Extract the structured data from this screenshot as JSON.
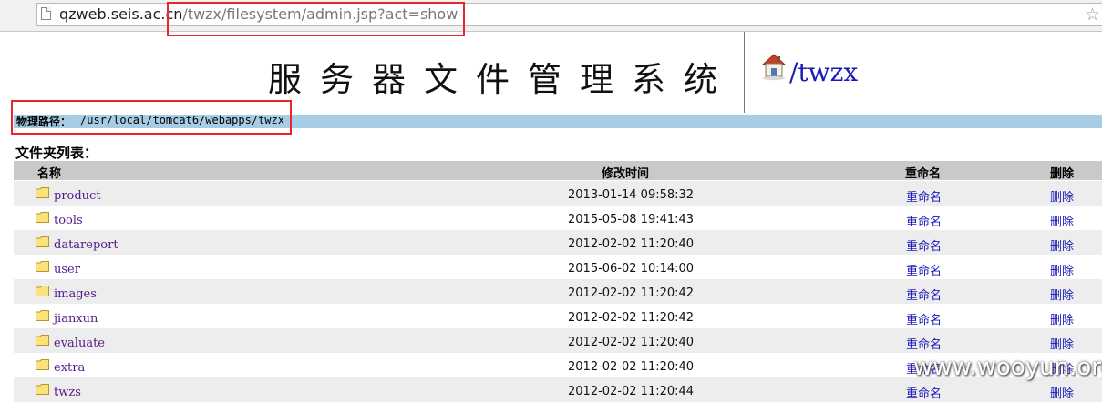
{
  "browser": {
    "url_host": "qzweb.seis.ac.cn",
    "url_path": "/twzx/filesystem/admin.jsp?act=show"
  },
  "header": {
    "title": "服务器文件管理系统",
    "site_link": "/twzx"
  },
  "path": {
    "label": "物理路径：",
    "value": "/usr/local/tomcat6/webapps/twzx"
  },
  "folders": {
    "section_title": "文件夹列表：",
    "columns": [
      "名称",
      "修改时间",
      "重命名",
      "删除"
    ],
    "rows": [
      {
        "name": "product",
        "modified": "2013-01-14 09:58:32",
        "rename": "重命名",
        "delete": "删除"
      },
      {
        "name": "tools",
        "modified": "2015-05-08 19:41:43",
        "rename": "重命名",
        "delete": "删除"
      },
      {
        "name": "datareport",
        "modified": "2012-02-02 11:20:40",
        "rename": "重命名",
        "delete": "删除"
      },
      {
        "name": "user",
        "modified": "2015-06-02 10:14:00",
        "rename": "重命名",
        "delete": "删除"
      },
      {
        "name": "images",
        "modified": "2012-02-02 11:20:42",
        "rename": "重命名",
        "delete": "删除"
      },
      {
        "name": "jianxun",
        "modified": "2012-02-02 11:20:42",
        "rename": "重命名",
        "delete": "删除"
      },
      {
        "name": "evaluate",
        "modified": "2012-02-02 11:20:40",
        "rename": "重命名",
        "delete": "删除"
      },
      {
        "name": "extra",
        "modified": "2012-02-02 11:20:40",
        "rename": "重命名",
        "delete": "删除"
      },
      {
        "name": "twzs",
        "modified": "2012-02-02 11:20:44",
        "rename": "重命名",
        "delete": "删除"
      }
    ]
  },
  "watermark": "www.wooyun.org",
  "colors": {
    "highlight": "#e8262c",
    "path_bar": "#a6cde6",
    "link": "#1a1ab8",
    "visited_link": "#551a8b",
    "table_header": "#c9c9c9",
    "row_stripe": "#ededed"
  },
  "icons": {
    "tab_page": "page-icon",
    "bookmark": "star-icon",
    "home": "home-icon",
    "folder": "folder-icon"
  }
}
